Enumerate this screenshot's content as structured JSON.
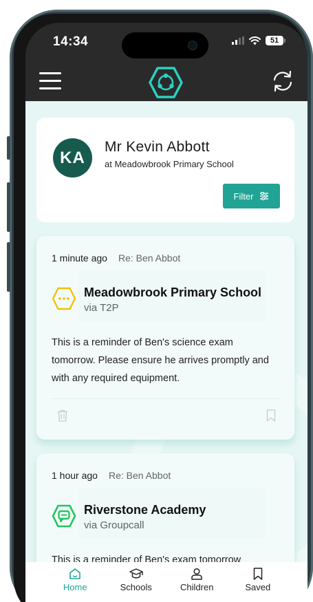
{
  "status_bar": {
    "time": "14:34",
    "battery": "51",
    "icons": [
      "signal-icon",
      "wifi-icon",
      "battery-icon"
    ]
  },
  "app_bar": {
    "menu_icon": "hamburger-menu-icon",
    "logo_icon": "hexagon-network-logo",
    "refresh_icon": "refresh-icon",
    "accent_color": "#2ad1c2"
  },
  "profile": {
    "initials": "KA",
    "name": "Mr Kevin Abbott",
    "school": "at Meadowbrook Primary School",
    "filter_label": "Filter",
    "filter_icon": "sliders-icon",
    "avatar_color": "#165b4e",
    "button_color": "#21a395"
  },
  "messages": [
    {
      "time": "1 minute ago",
      "re": "Re: Ben Abbot",
      "sender": "Meadowbrook Primary School",
      "via": "via T2P",
      "icon": "hexagon-dots-icon",
      "icon_color": "#f2c200",
      "body": "This is a reminder of Ben's science exam tomorrow. Please ensure he arrives promptly and with any required equipment.",
      "actions": [
        "trash-icon",
        "bookmark-icon"
      ]
    },
    {
      "time": "1 hour ago",
      "re": "Re: Ben Abbot",
      "sender": "Riverstone Academy",
      "via": "via Groupcall",
      "icon": "hexagon-chat-icon",
      "icon_color": "#22c55e",
      "body": "This is a reminder of Ben's exam tomorrow"
    }
  ],
  "tabs": [
    {
      "label": "Home",
      "icon": "home-icon",
      "active": true
    },
    {
      "label": "Schools",
      "icon": "graduation-cap-icon"
    },
    {
      "label": "Children",
      "icon": "person-icon"
    },
    {
      "label": "Saved",
      "icon": "bookmark-icon"
    }
  ]
}
